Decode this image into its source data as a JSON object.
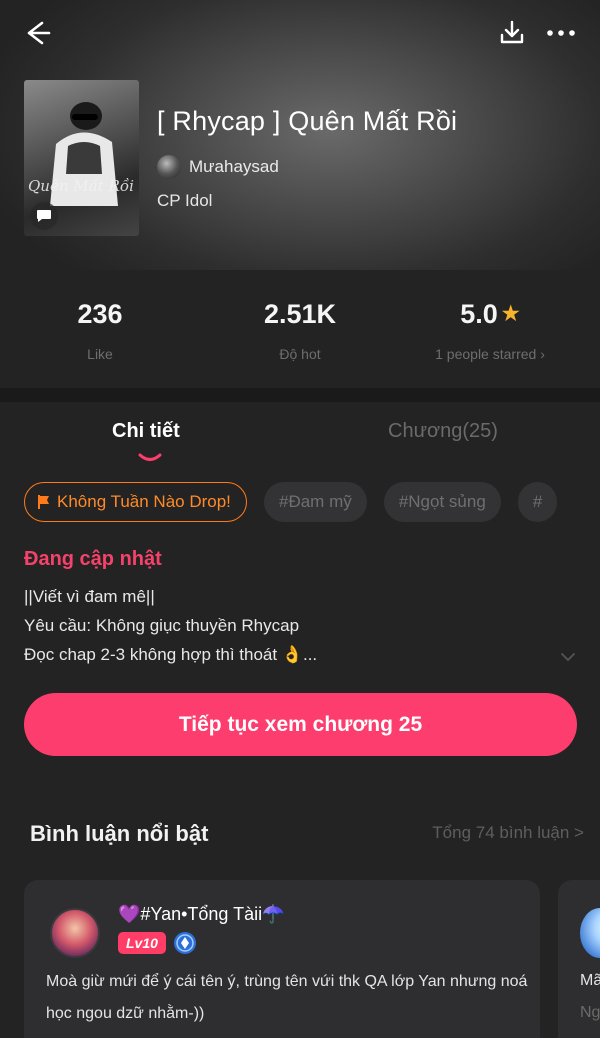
{
  "story": {
    "title": "[ Rhycap ] Quên Mất Rồi",
    "author": "Mưahaysad",
    "genre": "CP Idol",
    "cover_text": "Quên Mất Rồi"
  },
  "stats": {
    "likes": {
      "value": "236",
      "label": "Like"
    },
    "hot": {
      "value": "2.51K",
      "label": "Độ hot"
    },
    "rating": {
      "value": "5.0",
      "label": "1 people starred ›"
    }
  },
  "tabs": {
    "detail": "Chi tiết",
    "chapters": "Chương(25)"
  },
  "tags": [
    {
      "label": "Không Tuần Nào Drop!"
    },
    {
      "label": "#Đam mỹ"
    },
    {
      "label": "#Ngọt sủng"
    },
    {
      "label": "#"
    }
  ],
  "status": "Đang cập nhật",
  "description": {
    "line1": "||Viết vì đam mê||",
    "line2": "Yêu cầu: Không giục thuyền Rhycap",
    "line3": "Đọc chap 2-3 không hợp thì thoát 👌..."
  },
  "continue_button": "Tiếp tục xem chương 25",
  "comments": {
    "title": "Bình luận nổi bật",
    "total": "Tổng 74 bình luận >",
    "items": [
      {
        "name": "💜#Yan•Tổng Tàii☂️",
        "level": "Lv10",
        "text": "Moà giừ mứi để ý cái tên ý, trùng tên vứi thk QA lớp Yan nhưng noá học ngou dzữ nhằm-))"
      }
    ],
    "peek": {
      "line1": "Mã",
      "line2": "Ng"
    }
  },
  "colors": {
    "accent": "#fd3d6d",
    "status": "#f5426b",
    "drop_tag": "#ff7a1a",
    "star": "#f7b32b"
  },
  "icons": [
    "back-arrow-icon",
    "download-icon",
    "more-icon",
    "comment-icon",
    "star-icon",
    "flag-icon",
    "chevron-down-icon",
    "verified-icon"
  ]
}
